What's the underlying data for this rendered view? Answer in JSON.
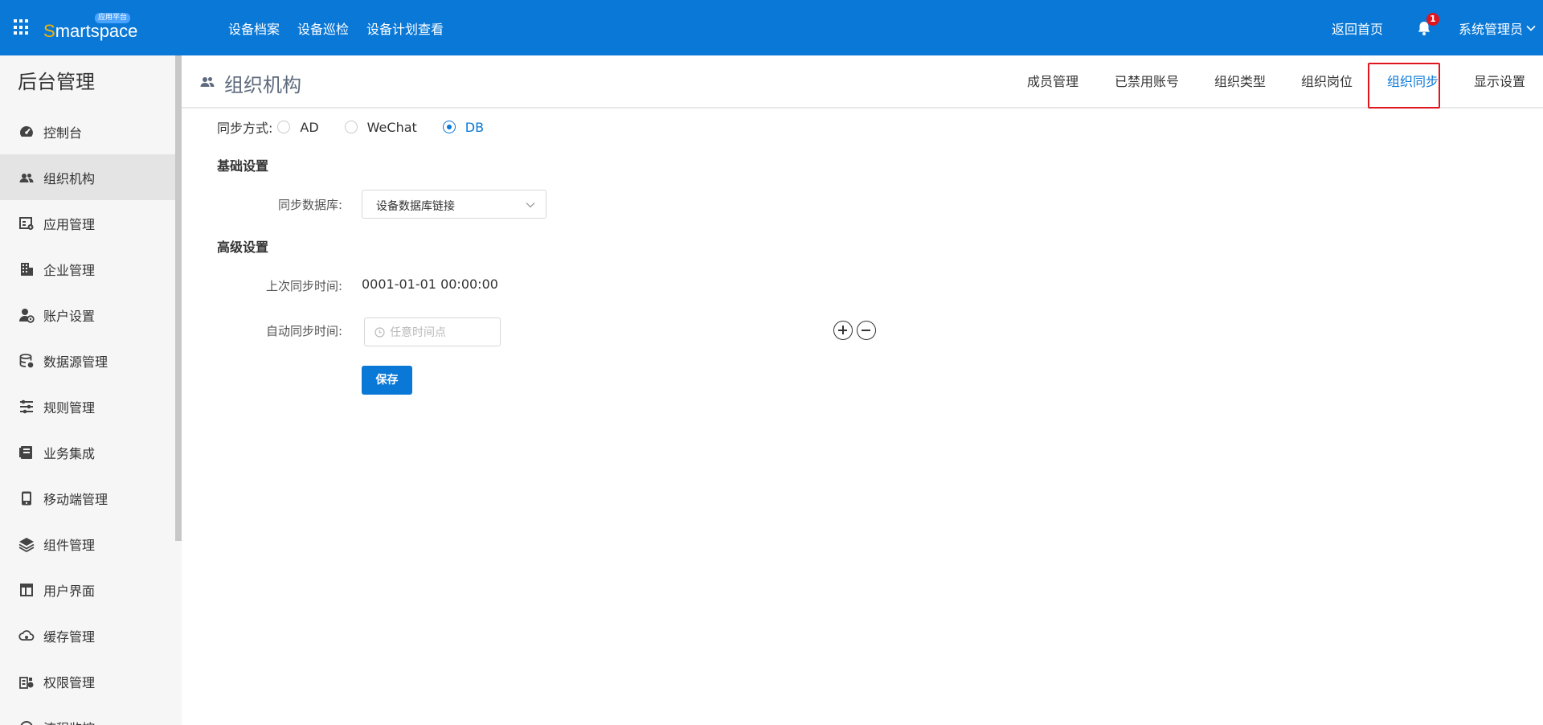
{
  "brand": {
    "name_first": "S",
    "name_rest": "martspace",
    "badge": "应用平台"
  },
  "topnav": [
    "设备档案",
    "设备巡检",
    "设备计划查看"
  ],
  "top_right": {
    "home": "返回首页",
    "notifications": "1",
    "user": "系统管理员"
  },
  "sidebar": {
    "title": "后台管理",
    "items": [
      {
        "label": "控制台",
        "icon": "dashboard-icon"
      },
      {
        "label": "组织机构",
        "icon": "users-icon",
        "active": true
      },
      {
        "label": "应用管理",
        "icon": "app-settings-icon"
      },
      {
        "label": "企业管理",
        "icon": "building-icon"
      },
      {
        "label": "账户设置",
        "icon": "user-gear-icon"
      },
      {
        "label": "数据源管理",
        "icon": "database-icon"
      },
      {
        "label": "规则管理",
        "icon": "sliders-icon"
      },
      {
        "label": "业务集成",
        "icon": "integration-icon"
      },
      {
        "label": "移动端管理",
        "icon": "mobile-icon"
      },
      {
        "label": "组件管理",
        "icon": "layers-icon"
      },
      {
        "label": "用户界面",
        "icon": "layout-icon"
      },
      {
        "label": "缓存管理",
        "icon": "cloud-cache-icon"
      },
      {
        "label": "权限管理",
        "icon": "permission-icon"
      },
      {
        "label": "流程监控",
        "icon": "flow-icon"
      }
    ]
  },
  "page": {
    "title": "组织机构"
  },
  "tabs": [
    {
      "label": "成员管理"
    },
    {
      "label": "已禁用账号"
    },
    {
      "label": "组织类型"
    },
    {
      "label": "组织岗位"
    },
    {
      "label": "组织同步",
      "active": true
    },
    {
      "label": "显示设置"
    }
  ],
  "sync": {
    "method_label": "同步方式:",
    "options": [
      "AD",
      "WeChat",
      "DB"
    ],
    "selected": "DB"
  },
  "basic": {
    "title": "基础设置",
    "db_label": "同步数据库:",
    "db_value": "设备数据库链接"
  },
  "advanced": {
    "title": "高级设置",
    "last_sync_label": "上次同步时间:",
    "last_sync_value": "0001-01-01 00:00:00",
    "auto_sync_label": "自动同步时间:",
    "auto_sync_placeholder": "任意时间点"
  },
  "actions": {
    "save": "保存"
  },
  "colors": {
    "primary": "#0a78d7",
    "highlight": "#e0161f",
    "brand_accent": "#f5b400"
  }
}
